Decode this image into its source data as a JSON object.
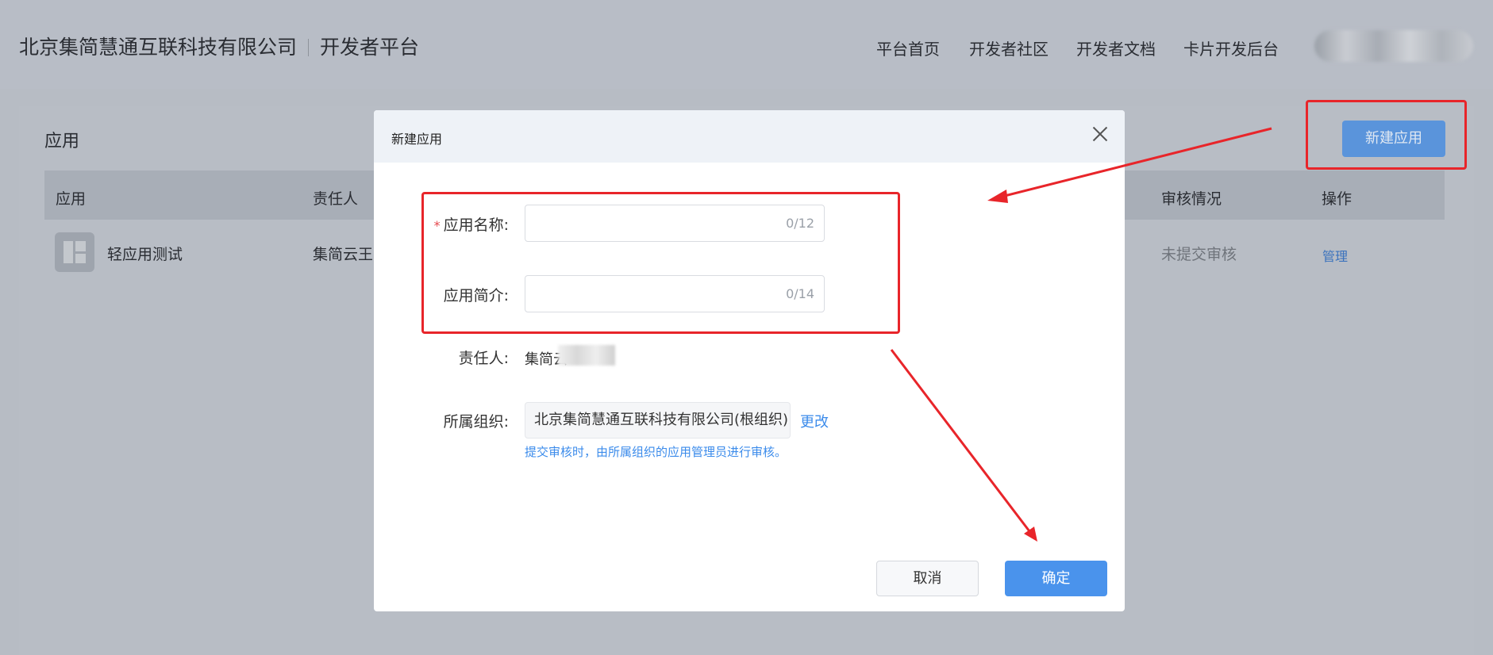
{
  "header": {
    "company": "北京集简慧通互联科技有限公司",
    "platform": "开发者平台",
    "nav": [
      "平台首页",
      "开发者社区",
      "开发者文档",
      "卡片开发后台"
    ]
  },
  "page": {
    "title": "应用",
    "new_app_button": "新建应用",
    "columns": {
      "app": "应用",
      "owner": "责任人",
      "review": "审核情况",
      "actions": "操作"
    },
    "rows": [
      {
        "name": "轻应用测试",
        "owner": "集简云王",
        "review": "未提交审核",
        "action": "管理"
      }
    ]
  },
  "modal": {
    "title": "新建应用",
    "fields": {
      "name_label": "应用名称:",
      "name_counter": "0/12",
      "desc_label": "应用简介:",
      "desc_counter": "0/14",
      "owner_label": "责任人:",
      "owner_value": "集简云",
      "org_label": "所属组织:",
      "org_value": "北京集简慧通互联科技有限公司(根组织)",
      "org_change": "更改",
      "org_hint": "提交审核时，由所属组织的应用管理员进行审核。"
    },
    "buttons": {
      "cancel": "取消",
      "ok": "确定"
    }
  },
  "colors": {
    "annotation": "#e8252a",
    "primary": "#4a93ec",
    "overlay_bg": "#b7bcc4"
  }
}
